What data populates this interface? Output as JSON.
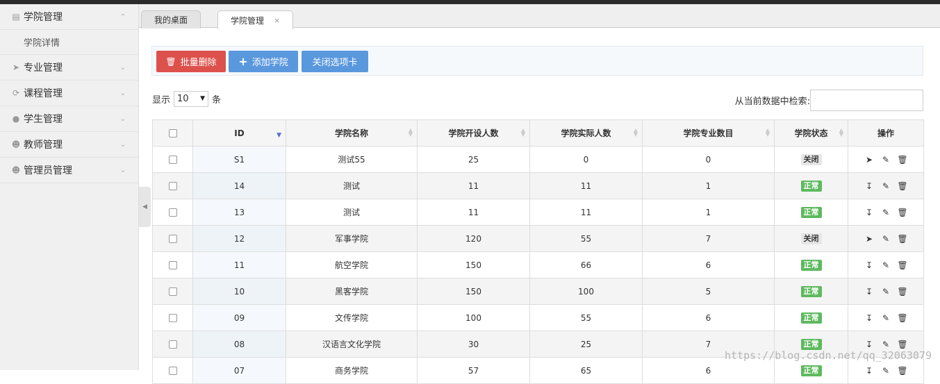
{
  "sidebar": {
    "items": [
      {
        "label": "学院管理",
        "icon": "building-icon",
        "expanded": true,
        "children": [
          {
            "label": "学院详情"
          }
        ]
      },
      {
        "label": "专业管理",
        "icon": "paper-plane-icon"
      },
      {
        "label": "课程管理",
        "icon": "refresh-icon"
      },
      {
        "label": "学生管理",
        "icon": "user-circle-icon"
      },
      {
        "label": "教师管理",
        "icon": "user-outline-icon"
      },
      {
        "label": "管理员管理",
        "icon": "user-solid-icon"
      }
    ]
  },
  "tabs": [
    {
      "label": "我的桌面",
      "active": false
    },
    {
      "label": "学院管理",
      "active": true,
      "close": "×"
    }
  ],
  "toolbar": {
    "batch_delete": "批量删除",
    "add_college": "添加学院",
    "close_tab": "关闭选项卡"
  },
  "length": {
    "prefix": "显示",
    "value": "10",
    "suffix": "条"
  },
  "search": {
    "label": "从当前数据中检索:"
  },
  "table": {
    "headers": [
      "ID",
      "学院名称",
      "学院开设人数",
      "学院实际人数",
      "学院专业数目",
      "学院状态",
      "操作"
    ],
    "rows": [
      {
        "id": "S1",
        "name": "测试55",
        "planned": "25",
        "actual": "0",
        "majors": "0",
        "status": "关闭",
        "active": false
      },
      {
        "id": "14",
        "name": "测试",
        "planned": "11",
        "actual": "11",
        "majors": "1",
        "status": "正常",
        "active": true
      },
      {
        "id": "13",
        "name": "测试",
        "planned": "11",
        "actual": "11",
        "majors": "1",
        "status": "正常",
        "active": true
      },
      {
        "id": "12",
        "name": "军事学院",
        "planned": "120",
        "actual": "55",
        "majors": "7",
        "status": "关闭",
        "active": false
      },
      {
        "id": "11",
        "name": "航空学院",
        "planned": "150",
        "actual": "66",
        "majors": "6",
        "status": "正常",
        "active": true
      },
      {
        "id": "10",
        "name": "黑客学院",
        "planned": "150",
        "actual": "100",
        "majors": "5",
        "status": "正常",
        "active": true
      },
      {
        "id": "09",
        "name": "文传学院",
        "planned": "100",
        "actual": "55",
        "majors": "6",
        "status": "正常",
        "active": true
      },
      {
        "id": "08",
        "name": "汉语言文化学院",
        "planned": "30",
        "actual": "25",
        "majors": "7",
        "status": "正常",
        "active": true
      },
      {
        "id": "07",
        "name": "商务学院",
        "planned": "57",
        "actual": "65",
        "majors": "6",
        "status": "正常",
        "active": true
      }
    ]
  },
  "watermark": "https://blog.csdn.net/qq_32063079",
  "colors": {
    "danger": "#dd514c",
    "primary": "#5a98de",
    "status_on": "#5eb95e",
    "status_off": "#e6e6e6"
  }
}
